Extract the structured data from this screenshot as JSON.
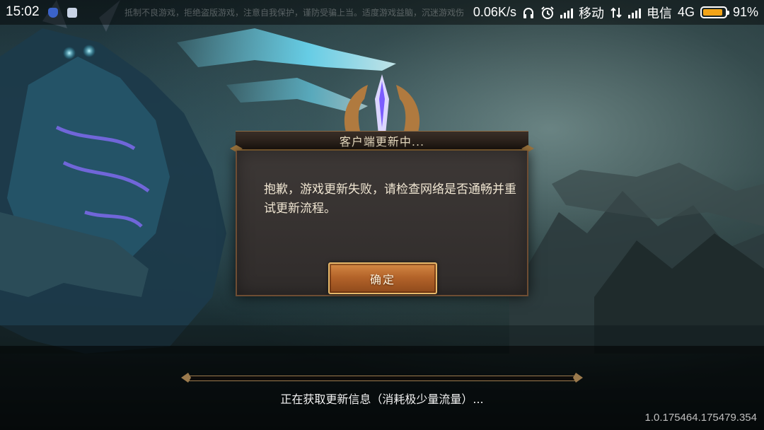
{
  "status_bar": {
    "time": "15:02",
    "marquee": "抵制不良游戏，拒绝盗版游戏，注意自我保护，谨防受骗上当。适度游戏益脑，沉迷游戏伤身，合理安排时间，享受健康生活。",
    "net_speed": "0.06K/s",
    "carrier1": "移动",
    "carrier2": "电信",
    "network_type": "4G",
    "battery_percent": "91%",
    "battery_level": 0.91,
    "icons": [
      "shield-icon",
      "app-notification-icon",
      "headphones-icon",
      "alarm-icon",
      "signal-icon",
      "data-arrows-icon",
      "battery-icon"
    ]
  },
  "dialog": {
    "title": "客户端更新中...",
    "message": "抱歉，游戏更新失败，请检查网络是否通畅并重试更新流程。",
    "confirm_label": "确定"
  },
  "footer": {
    "status_text": "正在获取更新信息（消耗极少量流量）...",
    "progress": 0,
    "version": "1.0.175464.175479.354"
  },
  "colors": {
    "accent_gold": "#d9a24a",
    "button_orange": "#b4642a",
    "battery": "#f2a417",
    "dialog_bg": "#363130"
  }
}
